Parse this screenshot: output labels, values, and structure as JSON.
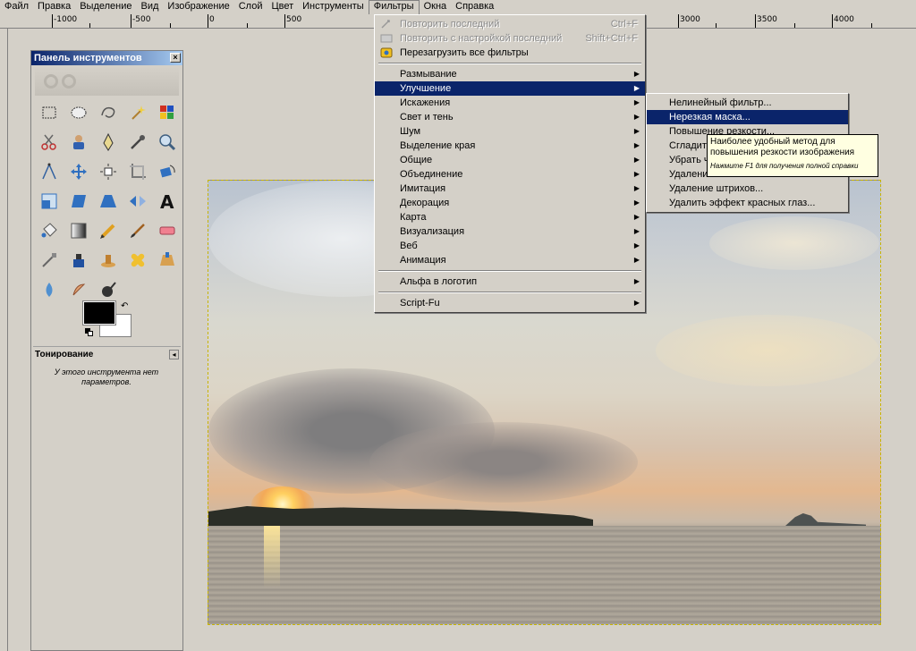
{
  "menubar": [
    {
      "label": "Файл"
    },
    {
      "label": "Правка"
    },
    {
      "label": "Выделение"
    },
    {
      "label": "Вид"
    },
    {
      "label": "Изображение"
    },
    {
      "label": "Слой"
    },
    {
      "label": "Цвет"
    },
    {
      "label": "Инструменты"
    },
    {
      "label": "Фильтры"
    },
    {
      "label": "Окна"
    },
    {
      "label": "Справка"
    }
  ],
  "ruler": {
    "labels": [
      "-1000",
      "-500",
      "0",
      "500",
      "3000",
      "3500",
      "4000"
    ]
  },
  "toolbox": {
    "title": "Панель инструментов",
    "tools": [
      "rect-select",
      "ellipse-select",
      "free-select",
      "fuzzy-select",
      "color-select",
      "scissors-select",
      "foreground-select",
      "paths",
      "color-picker",
      "zoom",
      "measure",
      "move",
      "align",
      "crop",
      "rotate",
      "scale",
      "shear",
      "perspective",
      "flip",
      "text",
      "bucket-fill",
      "blend",
      "pencil",
      "paintbrush",
      "eraser",
      "airbrush",
      "ink",
      "clone",
      "heal",
      "perspective-clone",
      "blur",
      "smudge",
      "dodge-burn"
    ],
    "colors": {
      "foreground": "#000000",
      "background": "#ffffff"
    },
    "tool_options_title": "Тонирование",
    "tool_options_text": "У этого инструмента нет параметров."
  },
  "filters_menu": {
    "repeat_last": "Повторить последний",
    "repeat_last_shortcut": "Ctrl+F",
    "reshow_last": "Повторить с настройкой последний",
    "reshow_last_shortcut": "Shift+Ctrl+F",
    "reset_all": "Перезагрузить все фильтры",
    "submenus": [
      "Размывание",
      "Улучшение",
      "Искажения",
      "Свет и тень",
      "Шум",
      "Выделение края",
      "Общие",
      "Объединение",
      "Имитация",
      "Декорация",
      "Карта",
      "Визуализация",
      "Веб",
      "Анимация"
    ],
    "alpha_to_logo": "Альфа в логотип",
    "script_fu": "Script-Fu",
    "selected_index": 1
  },
  "enhance_menu": {
    "items": [
      "Нелинейный фильтр...",
      "Нерезкая маска...",
      "Повышение резкости...",
      "Сгладить",
      "Убрать ч",
      "Удалени",
      "Удаление штрихов...",
      "Удалить эффект красных глаз..."
    ],
    "selected_index": 1
  },
  "tooltip": {
    "text": "Наиболее удобный метод для повышения резкости изображения",
    "hint": "Нажмите F1 для получения полной справки"
  },
  "colors": {
    "menu_highlight": "#0a246a",
    "window_bg": "#d4d0c8",
    "tooltip_bg": "#ffffe1"
  }
}
